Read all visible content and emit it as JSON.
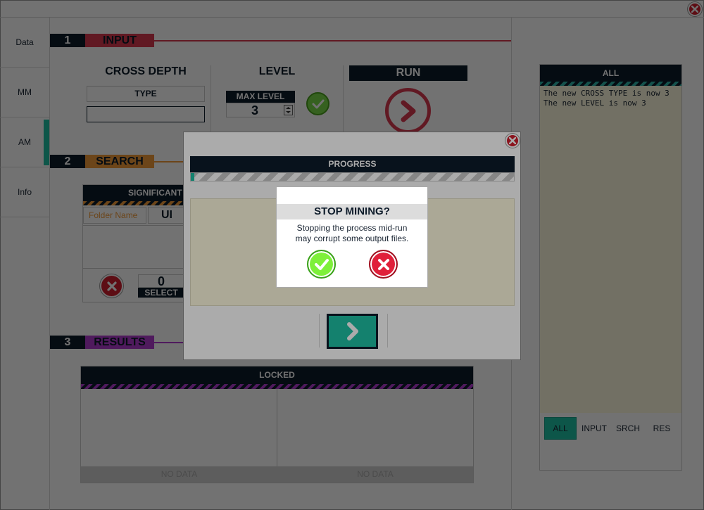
{
  "sidebar": {
    "tabs": [
      {
        "label": "Data"
      },
      {
        "label": "MM"
      },
      {
        "label": "AM"
      },
      {
        "label": "Info"
      }
    ]
  },
  "colors": {
    "navy": "#0d1b2a",
    "input_accent": "#d93a4f",
    "search_accent": "#f09a3a",
    "results_accent": "#b23bd0",
    "active_tab": "#1fc1a4"
  },
  "sections": {
    "input": {
      "number": "1",
      "title": "INPUT",
      "cross_depth": {
        "heading": "CROSS DEPTH",
        "type_label": "TYPE",
        "level_label": "LEVEL"
      },
      "level": {
        "heading": "LEVEL",
        "max_label": "MAX LEVEL",
        "value": "3"
      },
      "run": {
        "label": "RUN"
      }
    },
    "search": {
      "number": "2",
      "title": "SEARCH",
      "panel_header": "SIGNIFICANT F",
      "folder_placeholder": "Folder Name",
      "ui_label": "UI",
      "count": "0",
      "select_label": "SELECT"
    },
    "results": {
      "number": "3",
      "title": "RESULTS",
      "panel_header": "LOCKED",
      "col1_footer": "NO DATA",
      "col2_footer": "NO DATA"
    }
  },
  "log": {
    "header": "ALL",
    "lines": [
      "The new CROSS TYPE is now 3",
      "The new LEVEL is now 3"
    ],
    "filters": [
      {
        "label": "ALL",
        "active": true
      },
      {
        "label": "INPUT"
      },
      {
        "label": "SRCH"
      },
      {
        "label": "RES"
      }
    ]
  },
  "progress_dialog": {
    "header": "PROGRESS"
  },
  "confirm_dialog": {
    "title": "STOP MINING?",
    "message_line1": "Stopping the process mid-run",
    "message_line2": "may corrupt some output files."
  }
}
